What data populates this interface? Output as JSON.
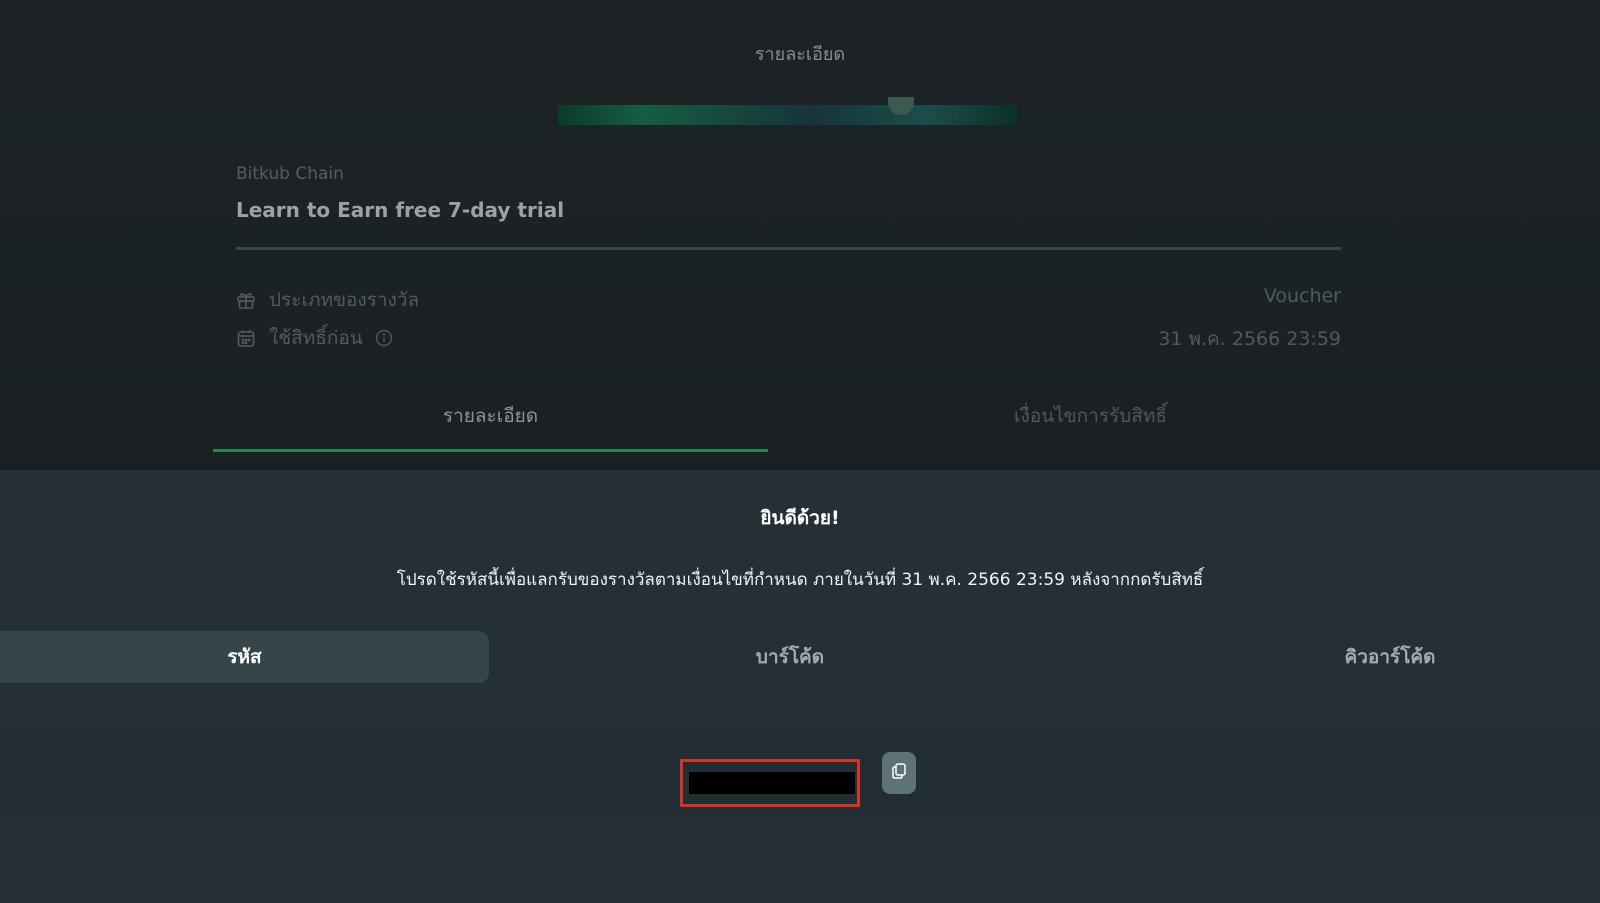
{
  "header": {
    "title": "รายละเอียด"
  },
  "reward": {
    "provider": "Bitkub Chain",
    "title": "Learn to Earn free 7-day trial",
    "type_label": "ประเภทของรางวัล",
    "type_value": "Voucher",
    "expiry_label": "ใช้สิทธิ์ก่อน",
    "expiry_value": "31 พ.ค. 2566 23:59"
  },
  "tabs": [
    {
      "label": "รายละเอียด",
      "active": true
    },
    {
      "label": "เงื่อนไขการรับสิทธิ์",
      "active": false
    }
  ],
  "sheet": {
    "heading": "ยินดีด้วย!",
    "instruction": "โปรดใช้รหัสนี้เพื่อแลกรับของรางวัลตามเงื่อนไขที่กำหนด ภายในวันที่ 31 พ.ค. 2566 23:59 หลังจากกดรับสิทธิ์",
    "code_tabs": [
      {
        "label": "รหัส",
        "active": true
      },
      {
        "label": "บาร์โค้ด",
        "active": false
      },
      {
        "label": "คิวอาร์โค้ด",
        "active": false
      }
    ]
  },
  "colors": {
    "accent_green": "#1f8a4e",
    "highlight_red": "#d93222"
  },
  "icons": [
    "gift-icon",
    "calendar-icon",
    "info-icon",
    "copy-icon"
  ]
}
